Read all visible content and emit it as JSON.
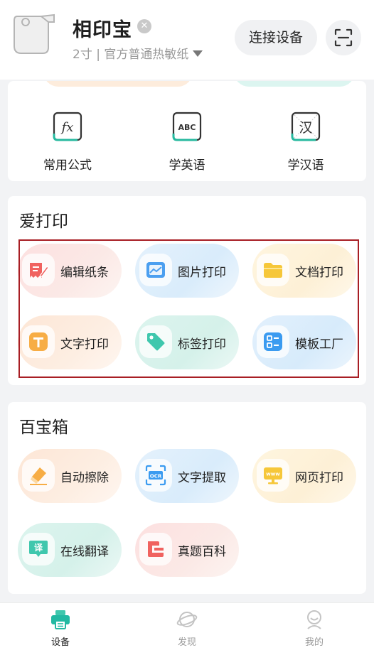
{
  "header": {
    "device_name": "相印宝",
    "device_sub": "2寸 | 官方普通热敏纸",
    "connect_label": "连接设备"
  },
  "tools_row": [
    {
      "label": "常用公式",
      "icon": "formula-icon"
    },
    {
      "label": "学英语",
      "icon": "abc-icon"
    },
    {
      "label": "学汉语",
      "icon": "chinese-char-icon"
    }
  ],
  "love_print": {
    "title": "爱打印",
    "items": [
      {
        "label": "编辑纸条",
        "icon": "edit-note-icon"
      },
      {
        "label": "图片打印",
        "icon": "image-icon"
      },
      {
        "label": "文档打印",
        "icon": "folder-icon"
      },
      {
        "label": "文字打印",
        "icon": "text-t-icon"
      },
      {
        "label": "标签打印",
        "icon": "tag-icon"
      },
      {
        "label": "模板工厂",
        "icon": "template-icon"
      }
    ]
  },
  "toolbox": {
    "title": "百宝箱",
    "items": [
      {
        "label": "自动擦除",
        "icon": "eraser-icon"
      },
      {
        "label": "文字提取",
        "icon": "ocr-icon"
      },
      {
        "label": "网页打印",
        "icon": "web-icon"
      },
      {
        "label": "在线翻译",
        "icon": "translate-icon"
      },
      {
        "label": "真题百科",
        "icon": "exam-icon"
      }
    ]
  },
  "tabs": [
    {
      "label": "设备",
      "icon": "printer-tab-icon",
      "active": true
    },
    {
      "label": "发现",
      "icon": "planet-icon",
      "active": false
    },
    {
      "label": "我的",
      "icon": "user-icon",
      "active": false
    }
  ],
  "colors": {
    "accent": "#22b9a2",
    "selection_border": "#a81e24",
    "inactive_tab": "#9a9a9a"
  }
}
